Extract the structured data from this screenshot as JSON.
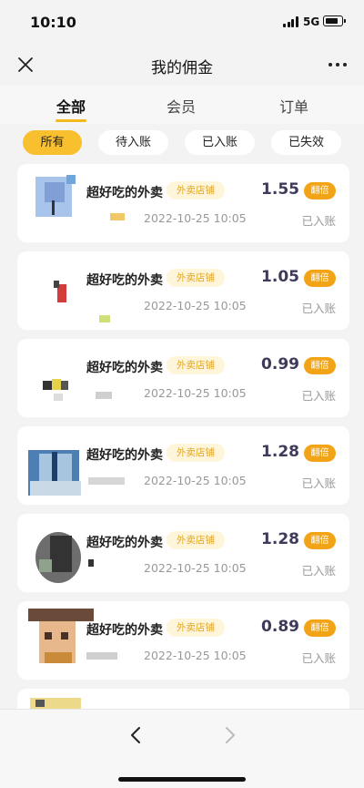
{
  "status_bar": {
    "time": "10:10",
    "network": "5G"
  },
  "nav": {
    "title": "我的佣金",
    "close_icon": "close-icon",
    "more_icon": "more-dots-icon"
  },
  "tabs": [
    {
      "label": "全部",
      "active": true
    },
    {
      "label": "会员",
      "active": false
    },
    {
      "label": "订单",
      "active": false
    }
  ],
  "filters": [
    {
      "label": "所有",
      "active": true
    },
    {
      "label": "待入账",
      "active": false
    },
    {
      "label": "已入账",
      "active": false
    },
    {
      "label": "已失效",
      "active": false
    }
  ],
  "records": [
    {
      "merchant": "超好吃的外卖",
      "tag": "外卖店铺",
      "amount": "1.55",
      "badge": "翻倍",
      "time": "2022-10-25 10:05",
      "status": "已入账"
    },
    {
      "merchant": "超好吃的外卖",
      "tag": "外卖店铺",
      "amount": "1.05",
      "badge": "翻倍",
      "time": "2022-10-25 10:05",
      "status": "已入账"
    },
    {
      "merchant": "超好吃的外卖",
      "tag": "外卖店铺",
      "amount": "0.99",
      "badge": "翻倍",
      "time": "2022-10-25 10:05",
      "status": "已入账"
    },
    {
      "merchant": "超好吃的外卖",
      "tag": "外卖店铺",
      "amount": "1.28",
      "badge": "翻倍",
      "time": "2022-10-25 10:05",
      "status": "已入账"
    },
    {
      "merchant": "超好吃的外卖",
      "tag": "外卖店铺",
      "amount": "1.28",
      "badge": "翻倍",
      "time": "2022-10-25 10:05",
      "status": "已入账"
    },
    {
      "merchant": "超好吃的外卖",
      "tag": "外卖店铺",
      "amount": "0.89",
      "badge": "翻倍",
      "time": "2022-10-25 10:05",
      "status": "已入账"
    }
  ],
  "colors": {
    "accent": "#f8bf2e",
    "badge": "#f3a316",
    "amount": "#3d3a5a",
    "tag_text": "#e3a520",
    "tag_bg": "#fff5da"
  },
  "bottom_bar": {
    "back_icon": "back-arrow-icon",
    "forward_icon": "forward-arrow-icon"
  }
}
